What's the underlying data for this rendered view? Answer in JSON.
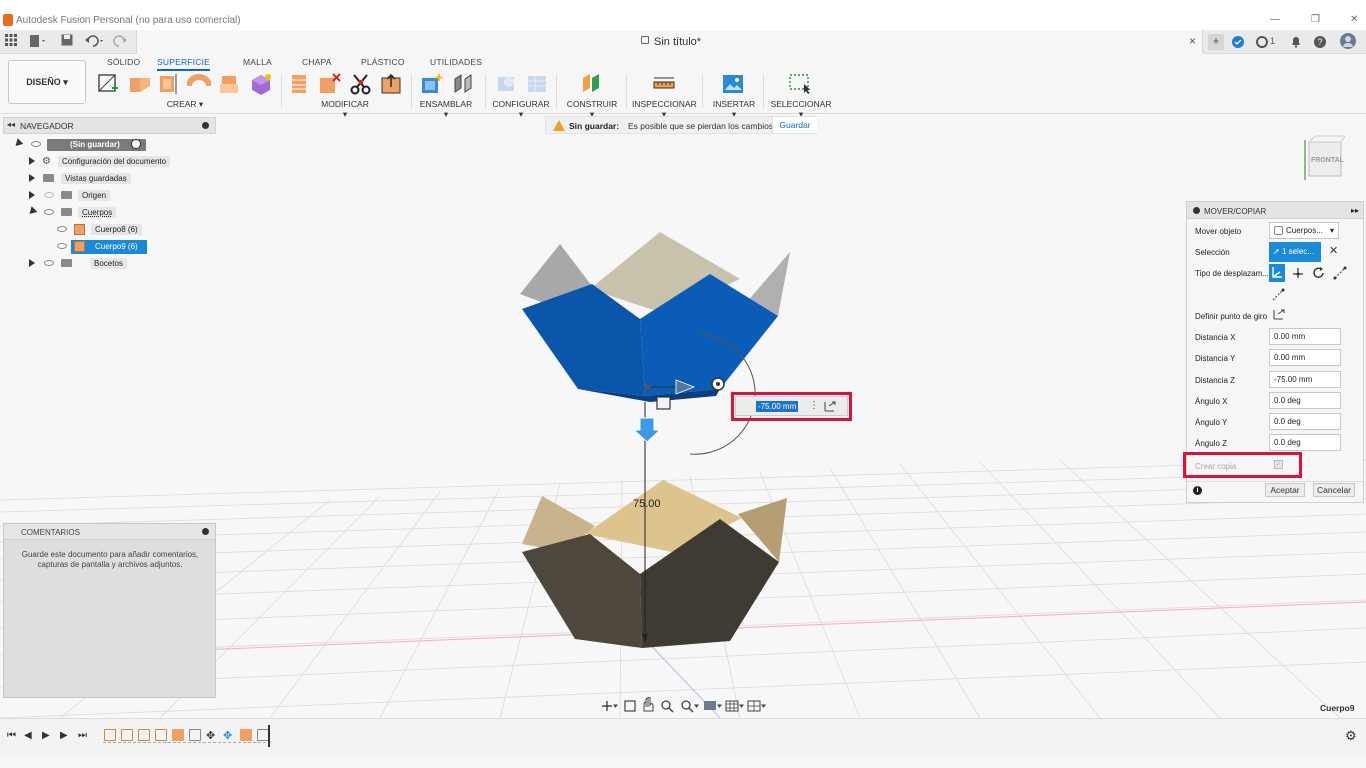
{
  "window": {
    "title": "Autodesk Fusion Personal (no para uso comercial)",
    "controls": [
      "—",
      "❐",
      "✕"
    ]
  },
  "tab": {
    "document_name": "Sin título*",
    "close": "×",
    "right_icons": [
      "plus-icon",
      "cloud-sync-icon",
      "job-status-icon",
      "notifications-icon",
      "help-icon",
      "profile-icon"
    ],
    "job_count": "1"
  },
  "toolbar": {
    "workspace": "DISEÑO ▾",
    "tabs": [
      "SÓLIDO",
      "SUPERFICIE",
      "MALLA",
      "CHAPA",
      "PLÁSTICO",
      "UTILIDADES"
    ],
    "active_tab": "SUPERFICIE",
    "groups": [
      "CREAR ▾",
      "MODIFICAR ▾",
      "ENSAMBLAR ▾",
      "CONFIGURAR ▾",
      "CONSTRUIR ▾",
      "INSPECCIONAR ▾",
      "INSERTAR ▾",
      "SELECCIONAR ▾"
    ],
    "tool_icons": [
      "create-sketch-icon",
      "extrude-icon",
      "revolve-icon",
      "sweep-icon",
      "loft-icon",
      "patch-icon",
      "offset-surface-icon",
      "delete-face-icon",
      "trim-icon",
      "stitch-icon",
      "new-component-icon",
      "joint-icon",
      "configure-icon",
      "configure-table-icon",
      "offset-plane-icon",
      "measure-icon",
      "insert-image-icon",
      "select-window-icon"
    ]
  },
  "navigator": {
    "title": "NAVEGADOR",
    "root": "(Sin guardar)",
    "items": [
      {
        "label": "Configuración del documento"
      },
      {
        "label": "Vistas guardadas"
      },
      {
        "label": "Origen"
      },
      {
        "label": "Cuerpos"
      },
      {
        "label": "Cuerpo8 (6)"
      },
      {
        "label": "Cuerpo9 (6)"
      },
      {
        "label": "Bocetos"
      }
    ]
  },
  "savebar": {
    "bold": "Sin guardar:",
    "message": "Es posible que se pierdan los cambios",
    "action": "Guardar"
  },
  "viewcube": {
    "label": "FRONTAL"
  },
  "viewport": {
    "dimension_label": "75.00",
    "input_value": "-75.00 mm"
  },
  "comments": {
    "title": "COMENTARIOS",
    "body": "Guarde este documento para añadir comentarios, capturas de pantalla y archivos adjuntos."
  },
  "movepanel": {
    "title": "MOVER/COPIAR",
    "fields": {
      "move_object_label": "Mover objeto",
      "move_object_value": "Cuerpos...",
      "selection_label": "Selección",
      "selection_value": "1 selec...",
      "move_type_label": "Tipo de desplazam...",
      "pivot_label": "Definir punto de giro",
      "dist_x_label": "Distancia X",
      "dist_x": "0.00 mm",
      "dist_y_label": "Distancia Y",
      "dist_y": "0.00 mm",
      "dist_z_label": "Distancia Z",
      "dist_z": "-75.00 mm",
      "ang_x_label": "Ángulo X",
      "ang_x": "0.0 deg",
      "ang_y_label": "Ángulo Y",
      "ang_y": "0.0 deg",
      "ang_z_label": "Ángulo Z",
      "ang_z": "0.0 deg",
      "copy_label": "Crear copia"
    },
    "ok": "Aceptar",
    "cancel": "Cancelar"
  },
  "status": {
    "selected_body": "Cuerpo9"
  },
  "colors": {
    "accent": "#0a69c8",
    "selected_body": "#0a56aa",
    "body_tan": "#d9c08a",
    "body_dark": "#4a4439",
    "highlight_box": "#e0103a"
  }
}
